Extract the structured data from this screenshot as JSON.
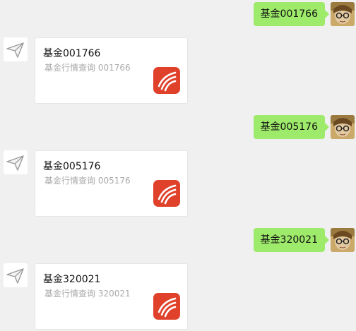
{
  "messages": [
    {
      "sent_text": "基金001766",
      "card_title": "基金001766",
      "card_desc": "基金行情查询 001766"
    },
    {
      "sent_text": "基金005176",
      "card_title": "基金005176",
      "card_desc": "基金行情查询 005176"
    },
    {
      "sent_text": "基金320021",
      "card_title": "基金320021",
      "card_desc": "基金行情查询 320021"
    }
  ],
  "icons": {
    "user_avatar": "user-avatar-photo",
    "bot_avatar": "paper-plane-icon",
    "card_thumb": "fund-app-logo-icon"
  },
  "colors": {
    "background": "#f0f0f0",
    "sent_bubble": "#9eea6a",
    "card_bg": "#ffffff",
    "desc_text": "#aaaaaa",
    "logo_red": "#e0412a"
  }
}
